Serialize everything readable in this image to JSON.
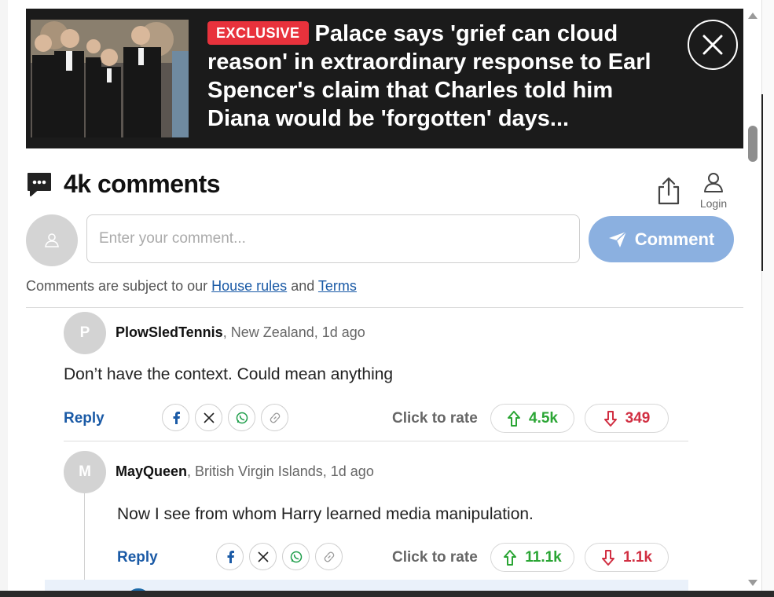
{
  "banner": {
    "badge": "EXCLUSIVE",
    "headline": "Palace says 'grief can cloud reason' in extraordinary response to Earl Spencer's claim that Charles told him Diana would be 'forgotten' days..."
  },
  "comments_header": {
    "count": "4k comments",
    "login_label": "Login"
  },
  "composer": {
    "placeholder": "Enter your comment...",
    "button_label": "Comment"
  },
  "rules": {
    "prefix": "Comments are subject to our",
    "house_rules": "House rules",
    "and": "and",
    "terms": "Terms"
  },
  "comments": [
    {
      "avatar_letter": "P",
      "username": "PlowSledTennis",
      "location_time": ", New Zealand, 1d ago",
      "text": "Don’t have the context. Could mean anything",
      "reply_label": "Reply",
      "rate_label": "Click to rate",
      "upvotes": "4.5k",
      "downvotes": "349"
    },
    {
      "avatar_letter": "M",
      "username": "MayQueen",
      "location_time": ", British Virgin Islands, 1d ago",
      "text": "Now I see from whom Harry learned media manipulation.",
      "reply_label": "Reply",
      "rate_label": "Click to rate",
      "upvotes": "11.1k",
      "downvotes": "1.1k"
    }
  ],
  "share_icons": [
    "facebook-icon",
    "x-icon",
    "whatsapp-icon",
    "link-icon"
  ],
  "colors": {
    "banner_bg": "#1b1b1b",
    "badge": "#e8323c",
    "link": "#1a5aa6",
    "comment_button": "#8bb0e0",
    "upvote": "#2aa534",
    "downvote": "#d12f42"
  }
}
